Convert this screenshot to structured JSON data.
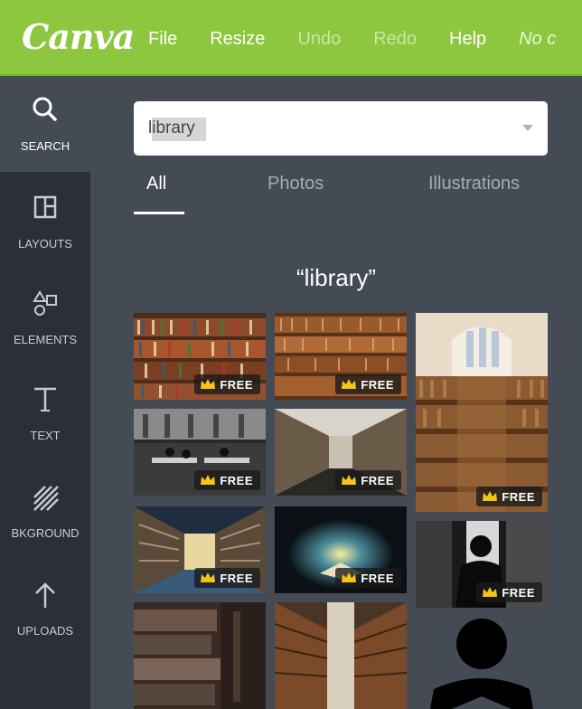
{
  "app": {
    "logo": "Canva",
    "menu": [
      {
        "label": "File",
        "state": "normal"
      },
      {
        "label": "Resize",
        "state": "normal"
      },
      {
        "label": "Undo",
        "state": "dim"
      },
      {
        "label": "Redo",
        "state": "dim"
      },
      {
        "label": "Help",
        "state": "normal"
      },
      {
        "label": "No c",
        "state": "italic"
      }
    ]
  },
  "rail": {
    "items": [
      {
        "label": "SEARCH",
        "icon": "search-icon",
        "active": true
      },
      {
        "label": "LAYOUTS",
        "icon": "layouts-icon",
        "active": false
      },
      {
        "label": "ELEMENTS",
        "icon": "elements-icon",
        "active": false
      },
      {
        "label": "TEXT",
        "icon": "text-icon",
        "active": false
      },
      {
        "label": "BKGROUND",
        "icon": "background-icon",
        "active": false
      },
      {
        "label": "UPLOADS",
        "icon": "uploads-icon",
        "active": false
      }
    ]
  },
  "search": {
    "value": "library",
    "placeholder": ""
  },
  "tabs": [
    {
      "label": "All",
      "active": true
    },
    {
      "label": "Photos",
      "active": false
    },
    {
      "label": "Illustrations",
      "active": false
    }
  ],
  "results": {
    "title": "“library”",
    "badge_label": "FREE",
    "items": [
      {
        "name": "bookshelves-colorful",
        "free": true
      },
      {
        "name": "bookshelves-wooden",
        "free": true
      },
      {
        "name": "grand-library-hall",
        "free": true
      },
      {
        "name": "reading-room-bw",
        "free": true
      },
      {
        "name": "library-corridor",
        "free": true
      },
      {
        "name": "library-aisle-blue",
        "free": true
      },
      {
        "name": "glowing-book-dark",
        "free": true
      },
      {
        "name": "silhouette-reader",
        "free": true
      },
      {
        "name": "stacked-books-closeup",
        "free": false
      },
      {
        "name": "narrow-aisle",
        "free": false
      },
      {
        "name": "reader-illustration",
        "free": false
      }
    ]
  },
  "colors": {
    "topbar": "#8dc63f",
    "rail": "#2b2f36",
    "panel": "#454b55",
    "crown": "#f5c518"
  }
}
